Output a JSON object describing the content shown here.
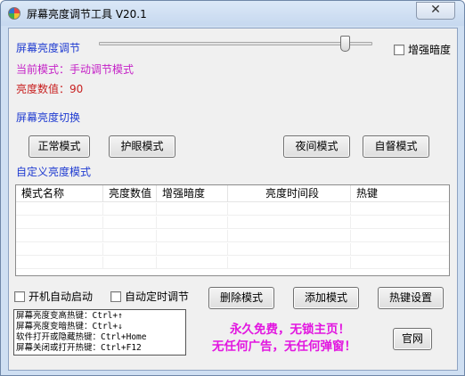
{
  "window": {
    "title": "屏幕亮度调节工具 V20.1",
    "close_glyph": "✕",
    "icon": "color-wheel-icon"
  },
  "brightness": {
    "label": "屏幕亮度调节",
    "level": 0.9,
    "enhance_dim_label": "增强暗度",
    "enhance_dim_checked": false,
    "current_mode_label": "当前模式：手动调节模式",
    "value_label": "亮度数值：90"
  },
  "switch": {
    "label": "屏幕亮度切换",
    "buttons": [
      "正常模式",
      "护眼模式",
      "夜间模式",
      "自督模式"
    ]
  },
  "custom": {
    "label": "自定义亮度模式",
    "columns": [
      "模式名称",
      "亮度数值",
      "增强暗度",
      "亮度时间段",
      "热键"
    ],
    "empty_rows": 5
  },
  "options": {
    "autostart_label": "开机自动启动",
    "autostart_checked": false,
    "timed_label": "自动定时调节",
    "timed_checked": false
  },
  "actions": {
    "delete_label": "删除模式",
    "add_label": "添加模式",
    "hotkey_settings_label": "热键设置",
    "website_label": "官网"
  },
  "hotkeys": [
    "屏幕亮度变高热键：Ctrl+↑",
    "屏幕亮度变暗热键：Ctrl+↓",
    "软件打开或隐藏热键：Ctrl+Home",
    "屏幕关闭或打开热键：Ctrl+F12"
  ],
  "promo": {
    "line1": "永久免费，无锁主页！",
    "line2": "无任何广告，无任何弹窗！"
  },
  "colors": {
    "blue_label": "#1f3bd1",
    "magenta_label": "#c522c7",
    "red_label": "#c82020",
    "promo": "#e216e0"
  }
}
